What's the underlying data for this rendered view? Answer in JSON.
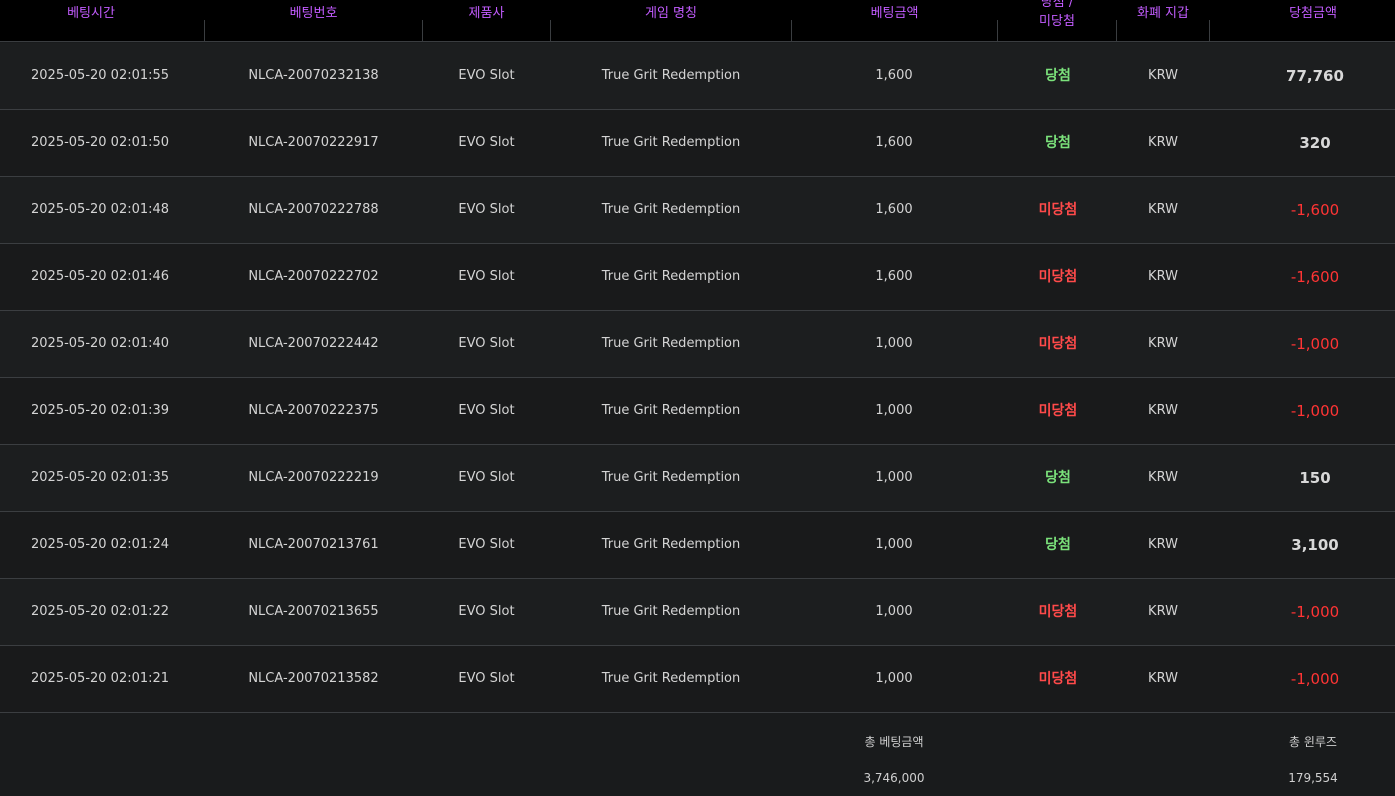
{
  "columns": {
    "bet_time": "베팅시간",
    "bet_number": "베팅번호",
    "provider": "제품사",
    "game_name": "게임 명칭",
    "bet_amount": "베팅금액",
    "result_line1": "당첨 /",
    "result_line2": "미당첨",
    "currency": "화폐 지갑",
    "win_amount": "당첨금액"
  },
  "rows": [
    {
      "time": "2025-05-20 02:01:55",
      "number": "NLCA-20070232138",
      "provider": "EVO Slot",
      "game": "True Grit Redemption",
      "bet": "1,600",
      "result": "당첨",
      "currency": "KRW",
      "amount": "77,760"
    },
    {
      "time": "2025-05-20 02:01:50",
      "number": "NLCA-20070222917",
      "provider": "EVO Slot",
      "game": "True Grit Redemption",
      "bet": "1,600",
      "result": "당첨",
      "currency": "KRW",
      "amount": "320"
    },
    {
      "time": "2025-05-20 02:01:48",
      "number": "NLCA-20070222788",
      "provider": "EVO Slot",
      "game": "True Grit Redemption",
      "bet": "1,600",
      "result": "미당첨",
      "currency": "KRW",
      "amount": "-1,600"
    },
    {
      "time": "2025-05-20 02:01:46",
      "number": "NLCA-20070222702",
      "provider": "EVO Slot",
      "game": "True Grit Redemption",
      "bet": "1,600",
      "result": "미당첨",
      "currency": "KRW",
      "amount": "-1,600"
    },
    {
      "time": "2025-05-20 02:01:40",
      "number": "NLCA-20070222442",
      "provider": "EVO Slot",
      "game": "True Grit Redemption",
      "bet": "1,000",
      "result": "미당첨",
      "currency": "KRW",
      "amount": "-1,000"
    },
    {
      "time": "2025-05-20 02:01:39",
      "number": "NLCA-20070222375",
      "provider": "EVO Slot",
      "game": "True Grit Redemption",
      "bet": "1,000",
      "result": "미당첨",
      "currency": "KRW",
      "amount": "-1,000"
    },
    {
      "time": "2025-05-20 02:01:35",
      "number": "NLCA-20070222219",
      "provider": "EVO Slot",
      "game": "True Grit Redemption",
      "bet": "1,000",
      "result": "당첨",
      "currency": "KRW",
      "amount": "150"
    },
    {
      "time": "2025-05-20 02:01:24",
      "number": "NLCA-20070213761",
      "provider": "EVO Slot",
      "game": "True Grit Redemption",
      "bet": "1,000",
      "result": "당첨",
      "currency": "KRW",
      "amount": "3,100"
    },
    {
      "time": "2025-05-20 02:01:22",
      "number": "NLCA-20070213655",
      "provider": "EVO Slot",
      "game": "True Grit Redemption",
      "bet": "1,000",
      "result": "미당첨",
      "currency": "KRW",
      "amount": "-1,000"
    },
    {
      "time": "2025-05-20 02:01:21",
      "number": "NLCA-20070213582",
      "provider": "EVO Slot",
      "game": "True Grit Redemption",
      "bet": "1,000",
      "result": "미당첨",
      "currency": "KRW",
      "amount": "-1,000"
    }
  ],
  "summary": {
    "total_bet_label": "총 베팅금액",
    "total_bet_value": "3,746,000",
    "total_winloss_label": "총 윈루즈",
    "total_winloss_value": "179,554"
  },
  "colors": {
    "header_text": "#c35cff",
    "win": "#7be27b",
    "lose": "#ff4a4a"
  }
}
